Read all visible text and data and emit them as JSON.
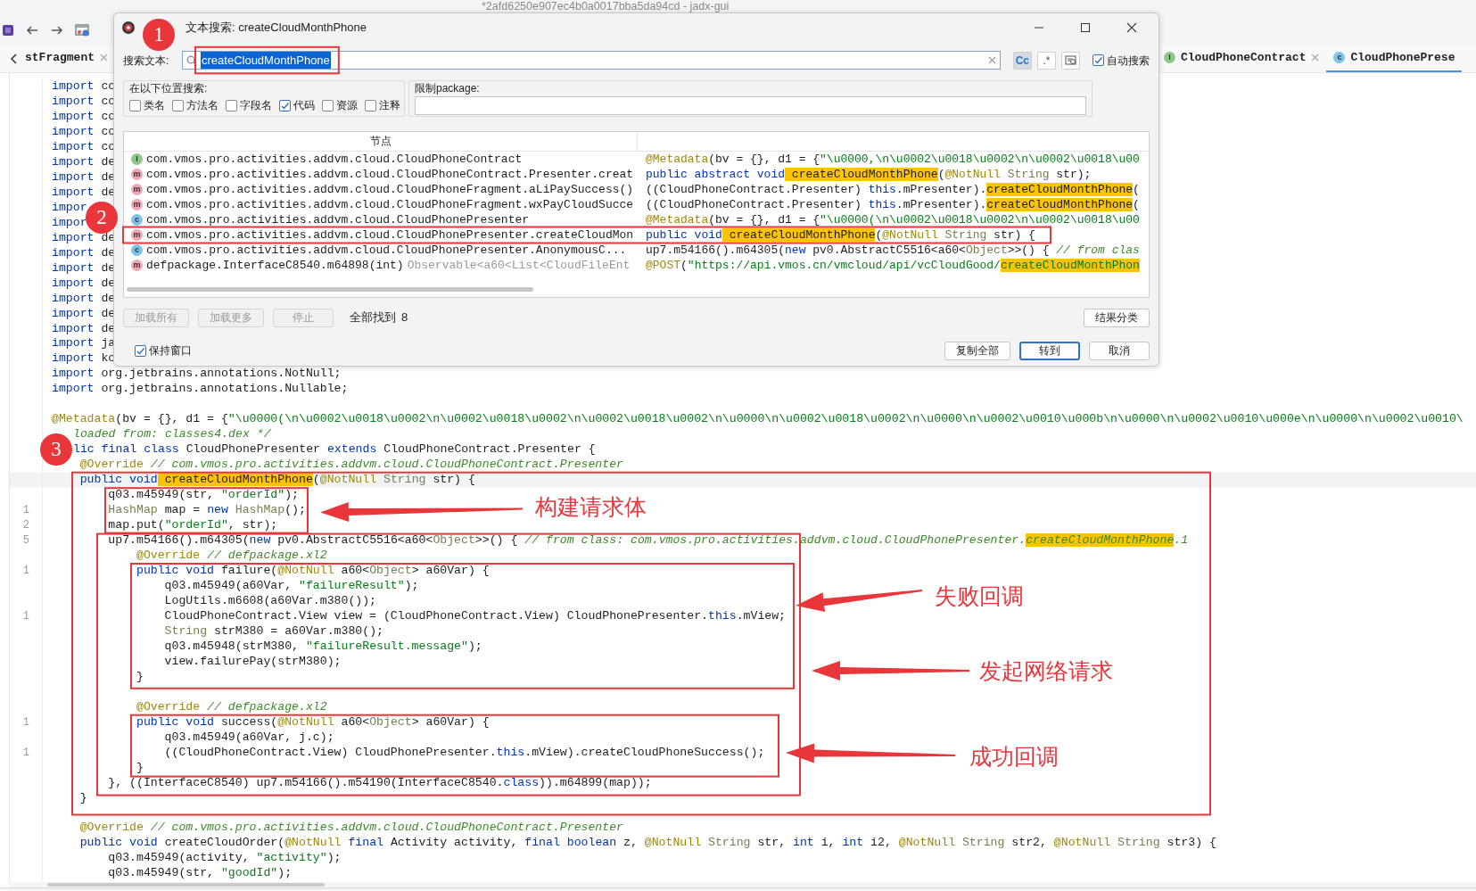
{
  "window": {
    "title": "*2afd6250e907ec4b0a0017bba5da94cd - jadx-gui"
  },
  "tabs": [
    {
      "label": "stFragment",
      "kind": "plain",
      "selected": false,
      "closable": true
    },
    {
      "label": "CloudPhoneContract",
      "kind": "interface",
      "badge": "I",
      "selected": false,
      "closable": true
    },
    {
      "label": "CloudPhonePrese",
      "kind": "class",
      "badge": "c",
      "selected": true,
      "closable": false
    }
  ],
  "editor": {
    "lines": [
      {
        "tokens": [
          {
            "kind": "k",
            "text": "import"
          },
          {
            "kind": "p",
            "text": " co"
          }
        ]
      },
      {
        "tokens": [
          {
            "kind": "k",
            "text": "import"
          },
          {
            "kind": "p",
            "text": " co"
          }
        ]
      },
      {
        "tokens": [
          {
            "kind": "k",
            "text": "import"
          },
          {
            "kind": "p",
            "text": " co"
          }
        ]
      },
      {
        "tokens": [
          {
            "kind": "k",
            "text": "import"
          },
          {
            "kind": "p",
            "text": " co"
          }
        ]
      },
      {
        "tokens": [
          {
            "kind": "k",
            "text": "import"
          },
          {
            "kind": "p",
            "text": " co"
          }
        ]
      },
      {
        "tokens": [
          {
            "kind": "k",
            "text": "import"
          },
          {
            "kind": "p",
            "text": " de"
          }
        ]
      },
      {
        "tokens": [
          {
            "kind": "k",
            "text": "import"
          },
          {
            "kind": "p",
            "text": " de"
          }
        ]
      },
      {
        "tokens": [
          {
            "kind": "k",
            "text": "import"
          },
          {
            "kind": "p",
            "text": " de"
          }
        ]
      },
      {
        "tokens": [
          {
            "kind": "k",
            "text": "impor"
          }
        ]
      },
      {
        "tokens": [
          {
            "kind": "k",
            "text": "impor"
          }
        ]
      },
      {
        "tokens": [
          {
            "kind": "k",
            "text": "import"
          },
          {
            "kind": "p",
            "text": " de"
          }
        ]
      },
      {
        "tokens": [
          {
            "kind": "k",
            "text": "import"
          },
          {
            "kind": "p",
            "text": " de"
          }
        ]
      },
      {
        "tokens": [
          {
            "kind": "k",
            "text": "import"
          },
          {
            "kind": "p",
            "text": " de"
          }
        ]
      },
      {
        "tokens": [
          {
            "kind": "k",
            "text": "import"
          },
          {
            "kind": "p",
            "text": " de"
          }
        ]
      },
      {
        "tokens": [
          {
            "kind": "k",
            "text": "import"
          },
          {
            "kind": "p",
            "text": " de"
          }
        ]
      },
      {
        "tokens": [
          {
            "kind": "k",
            "text": "import"
          },
          {
            "kind": "p",
            "text": " de"
          }
        ]
      },
      {
        "tokens": [
          {
            "kind": "k",
            "text": "import"
          },
          {
            "kind": "p",
            "text": " de"
          }
        ]
      },
      {
        "tokens": [
          {
            "kind": "k",
            "text": "import"
          },
          {
            "kind": "p",
            "text": " ja"
          }
        ]
      },
      {
        "tokens": [
          {
            "kind": "k",
            "text": "import"
          },
          {
            "kind": "p",
            "text": " ko"
          }
        ]
      },
      {
        "tokens": [
          {
            "kind": "k",
            "text": "import"
          },
          {
            "kind": "p",
            "text": " org.jetbrains.annotations.NotNull;"
          }
        ]
      },
      {
        "tokens": [
          {
            "kind": "k",
            "text": "import"
          },
          {
            "kind": "p",
            "text": " org.jetbrains.annotations.Nullable;"
          }
        ]
      },
      {
        "blank_before": true,
        "tokens": [
          {
            "kind": "a",
            "text": "@Metadata"
          },
          {
            "kind": "p",
            "text": "(bv = {}, d1 = {"
          },
          {
            "kind": "s",
            "text": "\"\\u0000(\\n\\u0002\\u0018\\u0002\\n\\u0002\\u0018\\u0002\\n\\u0002\\u0018\\u0002\\n\\u0000\\n\\u0002\\u0018\\u0002\\n\\u0000\\n\\u0002\\u0010\\u000b\\n\\u0000\\n\\u0002\\u0010\\u000e\\n\\u0000\\n\\u0002\\u0010\\"
          }
        ]
      },
      {
        "clipped_start": true,
        "tokens": [
          {
            "kind": "c",
            "text": "loaded from: classes4.dex */"
          }
        ]
      },
      {
        "clipped_start": true,
        "tokens": [
          {
            "kind": "k",
            "text": "lic final class"
          },
          {
            "kind": "p",
            "text": " CloudPhonePresenter "
          },
          {
            "kind": "k",
            "text": "extends"
          },
          {
            "kind": "p",
            "text": " CloudPhoneContract.Presenter {"
          }
        ]
      },
      {
        "tokens": [
          {
            "kind": "a",
            "text": "    @Override"
          },
          {
            "kind": "c",
            "text": " // com.vmos.pro.activities.addvm.cloud.CloudPhoneContract.Presenter"
          }
        ]
      },
      {
        "current": true,
        "tokens": [
          {
            "kind": "k",
            "text": "    public void"
          },
          {
            "kind": "m",
            "text": " createCloudMonthPhone"
          },
          {
            "kind": "p",
            "text": "("
          },
          {
            "kind": "a",
            "text": "@NotNull"
          },
          {
            "kind": "t",
            "text": " String"
          },
          {
            "kind": "p",
            "text": " str) {"
          }
        ]
      },
      {
        "tokens": [
          {
            "kind": "p",
            "text": "        q03.m45949(str, "
          },
          {
            "kind": "s",
            "text": "\"orderId\""
          },
          {
            "kind": "p",
            "text": ");"
          }
        ]
      },
      {
        "number": "1",
        "tokens": [
          {
            "kind": "t",
            "text": "        HashMap"
          },
          {
            "kind": "p",
            "text": " map = "
          },
          {
            "kind": "k",
            "text": "new"
          },
          {
            "kind": "t",
            "text": " HashMap"
          },
          {
            "kind": "p",
            "text": "();"
          }
        ]
      },
      {
        "number": "2",
        "tokens": [
          {
            "kind": "p",
            "text": "        map.put("
          },
          {
            "kind": "s",
            "text": "\"orderId\""
          },
          {
            "kind": "p",
            "text": ", str);"
          }
        ]
      },
      {
        "number": "5",
        "tokens": [
          {
            "kind": "p",
            "text": "        up7.m54166().m64305("
          },
          {
            "kind": "k",
            "text": "new"
          },
          {
            "kind": "p",
            "text": " pv0.AbstractC5516<a60<"
          },
          {
            "kind": "t",
            "text": "Object"
          },
          {
            "kind": "p",
            "text": ">>() { "
          },
          {
            "kind": "c",
            "text": "// from class: com.vmos.pro.activities.addvm.cloud.CloudPhonePresenter."
          },
          {
            "kind": "cm",
            "text": "createCloudMonthPhone"
          },
          {
            "kind": "c",
            "text": ".1"
          }
        ]
      },
      {
        "tokens": [
          {
            "kind": "a",
            "text": "            @Override"
          },
          {
            "kind": "c",
            "text": " // defpackage.xl2"
          }
        ]
      },
      {
        "number": "1",
        "tokens": [
          {
            "kind": "k",
            "text": "            public void"
          },
          {
            "kind": "p",
            "text": " failure("
          },
          {
            "kind": "a",
            "text": "@NotNull"
          },
          {
            "kind": "p",
            "text": " a60<"
          },
          {
            "kind": "t",
            "text": "Object"
          },
          {
            "kind": "p",
            "text": "> a60Var) {"
          }
        ]
      },
      {
        "tokens": [
          {
            "kind": "p",
            "text": "                q03.m45949(a60Var, "
          },
          {
            "kind": "s",
            "text": "\"failureResult\""
          },
          {
            "kind": "p",
            "text": ");"
          }
        ]
      },
      {
        "tokens": [
          {
            "kind": "p",
            "text": "                LogUtils.m6608(a60Var.m380());"
          }
        ]
      },
      {
        "number": "1",
        "tokens": [
          {
            "kind": "p",
            "text": "                CloudPhoneContract.View view = (CloudPhoneContract.View) CloudPhonePresenter."
          },
          {
            "kind": "k",
            "text": "this"
          },
          {
            "kind": "p",
            "text": ".mView;"
          }
        ]
      },
      {
        "tokens": [
          {
            "kind": "t",
            "text": "                String"
          },
          {
            "kind": "p",
            "text": " strM380 = a60Var.m380();"
          }
        ]
      },
      {
        "tokens": [
          {
            "kind": "p",
            "text": "                q03.m45948(strM380, "
          },
          {
            "kind": "s",
            "text": "\"failureResult.message\""
          },
          {
            "kind": "p",
            "text": ");"
          }
        ]
      },
      {
        "tokens": [
          {
            "kind": "p",
            "text": "                view.failurePay(strM380);"
          }
        ]
      },
      {
        "tokens": [
          {
            "kind": "p",
            "text": "            }"
          }
        ]
      },
      {
        "blank_before": true,
        "tokens": [
          {
            "kind": "a",
            "text": "            @Override"
          },
          {
            "kind": "c",
            "text": " // defpackage.xl2"
          }
        ]
      },
      {
        "number": "1",
        "tokens": [
          {
            "kind": "k",
            "text": "            public void"
          },
          {
            "kind": "p",
            "text": " success("
          },
          {
            "kind": "a",
            "text": "@NotNull"
          },
          {
            "kind": "p",
            "text": " a60<"
          },
          {
            "kind": "t",
            "text": "Object"
          },
          {
            "kind": "p",
            "text": "> a60Var) {"
          }
        ]
      },
      {
        "tokens": [
          {
            "kind": "p",
            "text": "                q03.m45949(a60Var, j.c);"
          }
        ]
      },
      {
        "number": "1",
        "tokens": [
          {
            "kind": "p",
            "text": "                ((CloudPhoneContract.View) CloudPhonePresenter."
          },
          {
            "kind": "k",
            "text": "this"
          },
          {
            "kind": "p",
            "text": ".mView).createCloudPhoneSuccess();"
          }
        ]
      },
      {
        "tokens": [
          {
            "kind": "p",
            "text": "            }"
          }
        ]
      },
      {
        "tokens": [
          {
            "kind": "p",
            "text": "        }, ((InterfaceC8540) up7.m54166().m54190(InterfaceC8540."
          },
          {
            "kind": "k",
            "text": "class"
          },
          {
            "kind": "p",
            "text": ")).m64899(map));"
          }
        ]
      },
      {
        "tokens": [
          {
            "kind": "p",
            "text": "    }"
          }
        ]
      },
      {
        "blank_before": true,
        "tokens": [
          {
            "kind": "a",
            "text": "    @Override"
          },
          {
            "kind": "c",
            "text": " // com.vmos.pro.activities.addvm.cloud.CloudPhoneContract.Presenter"
          }
        ]
      },
      {
        "tokens": [
          {
            "kind": "k",
            "text": "    public void"
          },
          {
            "kind": "p",
            "text": " createCloudOrder("
          },
          {
            "kind": "a",
            "text": "@NotNull"
          },
          {
            "kind": "k",
            "text": " final"
          },
          {
            "kind": "p",
            "text": " Activity activity, "
          },
          {
            "kind": "k",
            "text": "final boolean"
          },
          {
            "kind": "p",
            "text": " z, "
          },
          {
            "kind": "a",
            "text": "@NotNull"
          },
          {
            "kind": "t",
            "text": " String"
          },
          {
            "kind": "p",
            "text": " str, "
          },
          {
            "kind": "k",
            "text": "int"
          },
          {
            "kind": "p",
            "text": " i, "
          },
          {
            "kind": "k",
            "text": "int"
          },
          {
            "kind": "p",
            "text": " i2, "
          },
          {
            "kind": "a",
            "text": "@NotNull"
          },
          {
            "kind": "t",
            "text": " String"
          },
          {
            "kind": "p",
            "text": " str2, "
          },
          {
            "kind": "a",
            "text": "@NotNull"
          },
          {
            "kind": "t",
            "text": " String"
          },
          {
            "kind": "p",
            "text": " str3) {"
          }
        ]
      },
      {
        "tokens": [
          {
            "kind": "p",
            "text": "        q03.m45949(activity, "
          },
          {
            "kind": "s",
            "text": "\"activity\""
          },
          {
            "kind": "p",
            "text": ");"
          }
        ]
      },
      {
        "tokens": [
          {
            "kind": "p",
            "text": "        q03.m45949(str, "
          },
          {
            "kind": "s",
            "text": "\"goodId\""
          },
          {
            "kind": "p",
            "text": ");"
          }
        ]
      }
    ]
  },
  "dialog": {
    "title": "文本搜索: createCloudMonthPhone",
    "search_label": "搜索文本:",
    "search_value": "createCloudMonthPhone",
    "options": [
      {
        "label": "Cc",
        "selected": true
      },
      {
        "label": ".*",
        "selected": false
      }
    ],
    "auto_search": {
      "label": "自动搜索",
      "checked": true
    },
    "scope": {
      "title": "在以下位置搜索:",
      "items": [
        {
          "label": "类名",
          "checked": false
        },
        {
          "label": "方法名",
          "checked": false
        },
        {
          "label": "字段名",
          "checked": false
        },
        {
          "label": "代码",
          "checked": true
        },
        {
          "label": "资源",
          "checked": false
        },
        {
          "label": "注释",
          "checked": false
        }
      ]
    },
    "package": {
      "title": "限制package:"
    },
    "results": {
      "header": "节点",
      "rows": [
        {
          "kind": "interface",
          "badge": "I",
          "node": "com.vmos.pro.activities.addvm.cloud.CloudPhoneContract",
          "code": [
            {
              "kind": "a",
              "text": "@Metadata"
            },
            {
              "kind": "p",
              "text": "(bv = {}, d1 = {"
            },
            {
              "kind": "s",
              "text": "\"\\u0000,\\n\\u0002\\u0018\\u0002\\n\\u0002\\u0018\\u00"
            }
          ]
        },
        {
          "kind": "method",
          "badge": "m",
          "node": "com.vmos.pro.activities.addvm.cloud.CloudPhoneContract.Presenter.creat",
          "code": [
            {
              "kind": "k",
              "text": "public abstract void"
            },
            {
              "kind": "m",
              "text": " createCloudMonthPhone"
            },
            {
              "kind": "p",
              "text": "("
            },
            {
              "kind": "a",
              "text": "@NotNull"
            },
            {
              "kind": "t",
              "text": " String"
            },
            {
              "kind": "p",
              "text": " str);"
            }
          ]
        },
        {
          "kind": "method",
          "badge": "m",
          "node": "com.vmos.pro.activities.addvm.cloud.CloudPhoneFragment.aLiPaySuccess()",
          "code": [
            {
              "kind": "p",
              "text": "((CloudPhoneContract.Presenter) "
            },
            {
              "kind": "k",
              "text": "this"
            },
            {
              "kind": "p",
              "text": ".mPresenter)."
            },
            {
              "kind": "m",
              "text": "createCloudMonthPhone"
            },
            {
              "kind": "p",
              "text": "("
            }
          ]
        },
        {
          "kind": "method",
          "badge": "m",
          "node": "com.vmos.pro.activities.addvm.cloud.CloudPhoneFragment.wxPayCloudSucce",
          "code": [
            {
              "kind": "p",
              "text": "((CloudPhoneContract.Presenter) "
            },
            {
              "kind": "k",
              "text": "this"
            },
            {
              "kind": "p",
              "text": ".mPresenter)."
            },
            {
              "kind": "m",
              "text": "createCloudMonthPhone"
            },
            {
              "kind": "p",
              "text": "("
            }
          ]
        },
        {
          "kind": "class",
          "badge": "c",
          "node": "com.vmos.pro.activities.addvm.cloud.CloudPhonePresenter",
          "code": [
            {
              "kind": "a",
              "text": "@Metadata"
            },
            {
              "kind": "p",
              "text": "(bv = {}, d1 = {"
            },
            {
              "kind": "s",
              "text": "\"\\u0000(\\n\\u0002\\u0018\\u0002\\n\\u0002\\u0018\\u00"
            }
          ]
        },
        {
          "kind": "method",
          "badge": "m",
          "node": "com.vmos.pro.activities.addvm.cloud.CloudPhonePresenter.createCloudMon",
          "code": [
            {
              "kind": "k",
              "text": "public void"
            },
            {
              "kind": "m",
              "text": " createCloudMonthPhone"
            },
            {
              "kind": "p",
              "text": "("
            },
            {
              "kind": "a",
              "text": "@NotNull"
            },
            {
              "kind": "t",
              "text": " String"
            },
            {
              "kind": "p",
              "text": " str) {"
            }
          ]
        },
        {
          "kind": "class",
          "badge": "c",
          "node": "com.vmos.pro.activities.addvm.cloud.CloudPhonePresenter.AnonymousC...",
          "code": [
            {
              "kind": "p",
              "text": "up7.m54166().m64305("
            },
            {
              "kind": "k",
              "text": "new"
            },
            {
              "kind": "p",
              "text": " pv0.AbstractC5516<a60<"
            },
            {
              "kind": "t",
              "text": "Object"
            },
            {
              "kind": "p",
              "text": ">>() { "
            },
            {
              "kind": "c",
              "text": "// from clas"
            }
          ]
        },
        {
          "kind": "method",
          "badge": "m",
          "node": "defpackage.InterfaceC8540.m64898(int)",
          "detail": "Observable<a60<List<CloudFileEnt",
          "code": [
            {
              "kind": "a",
              "text": "@POST"
            },
            {
              "kind": "p",
              "text": "("
            },
            {
              "kind": "s",
              "text": "\"https://api.vmos.cn/vmcloud/api/vcCloudGood/"
            },
            {
              "kind": "sm",
              "text": "createCloudMonthPhon"
            }
          ]
        }
      ]
    },
    "action_buttons": [
      {
        "label": "加载所有",
        "disabled": true
      },
      {
        "label": "加载更多",
        "disabled": true
      },
      {
        "label": "停止",
        "disabled": true
      }
    ],
    "found": {
      "label": "全部找到",
      "count": "8"
    },
    "classify_button": {
      "label": "结果分类"
    },
    "keep_window": {
      "label": "保持窗口",
      "checked": true
    },
    "footer_buttons": [
      {
        "label": "复制全部",
        "default": false
      },
      {
        "label": "转到",
        "default": true
      },
      {
        "label": "取消",
        "default": false
      }
    ]
  },
  "annotations": {
    "steps": [
      {
        "label": "1"
      },
      {
        "label": "2"
      },
      {
        "label": "3"
      }
    ],
    "callouts": [
      {
        "label": "构建请求体"
      },
      {
        "label": "失败回调"
      },
      {
        "label": "发起网络请求"
      },
      {
        "label": "成功回调"
      }
    ]
  }
}
